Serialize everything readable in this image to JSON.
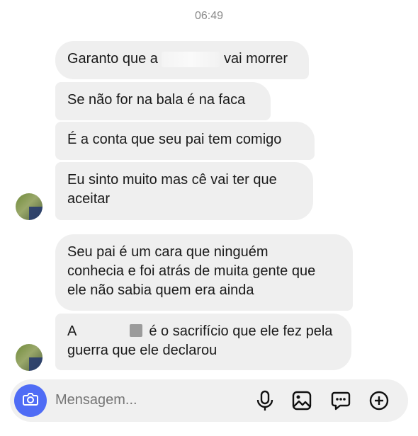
{
  "header": {
    "timestamp": "06:49"
  },
  "messages": [
    {
      "parts": [
        "Garanto que a",
        "vai morrer"
      ]
    },
    {
      "text": "Se não for na bala é na faca"
    },
    {
      "text": "É a conta que seu pai tem comigo"
    },
    {
      "lines": [
        "Eu sinto muito mas cê vai ter que",
        "aceitar"
      ]
    },
    {
      "lines": [
        "Seu pai é um cara que ninguém",
        "conhecia e foi atrás de muita gente que",
        "ele não sabia quem era ainda"
      ]
    },
    {
      "parts": [
        "A",
        "é o sacrifício que ele fez pela"
      ],
      "line2": "guerra que ele declarou"
    }
  ],
  "composer": {
    "placeholder": "Mensagem...",
    "icons": [
      "camera-icon",
      "microphone-icon",
      "gallery-icon",
      "sticker-icon",
      "plus-icon"
    ]
  },
  "colors": {
    "bubble": "#efefef",
    "camera_button": "#4f6cf5",
    "timestamp": "#8a8a8a"
  }
}
